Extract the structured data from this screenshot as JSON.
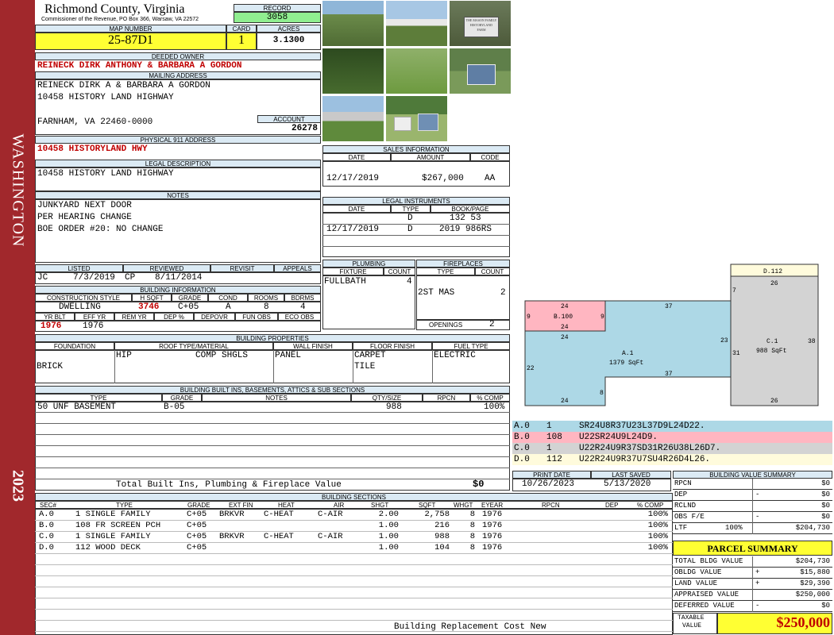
{
  "sidebar": {
    "district": "WASHINGTON",
    "year": "2023"
  },
  "header": {
    "county": "Richmond County, Virginia",
    "commissioner": "Commissioner of the Revenue, PO Box 366, Warsaw, VA 22572",
    "record_label": "RECORD",
    "record": "3058",
    "map_label": "MAP NUMBER",
    "map": "25-87D1",
    "card_label": "CARD",
    "card": "1",
    "acres_label": "ACRES",
    "acres": "3.1300"
  },
  "owner": {
    "label": "DEEDED OWNER",
    "value": "REINECK DIRK ANTHONY & BARBARA A GORDON"
  },
  "mailing": {
    "label": "MAILING ADDRESS",
    "line1": "REINECK DIRK A & BARBARA A GORDON",
    "line2": "10458 HISTORY LAND HIGHWAY",
    "line3": "FARNHAM, VA 22460-0000",
    "account_label": "ACCOUNT",
    "account": "26278"
  },
  "physical": {
    "label": "PHYSICAL 911 ADDRESS",
    "value": "10458 HISTORYLAND HWY"
  },
  "legal": {
    "label": "LEGAL DESCRIPTION",
    "value": "10458 HISTORY LAND HIGHWAY"
  },
  "notes": {
    "label": "NOTES",
    "line1": "JUNKYARD NEXT DOOR",
    "line2": "PER HEARING CHANGE",
    "line3": "BOE ORDER #20: NO CHANGE"
  },
  "photos": {
    "sign_text": "THE MASON FAMILY HISTORYLAND FARM"
  },
  "sales": {
    "label": "SALES INFORMATION",
    "h_date": "DATE",
    "h_amount": "AMOUNT",
    "h_code": "CODE",
    "date": "12/17/2019",
    "amount": "$267,000",
    "code": "AA"
  },
  "instruments": {
    "label": "LEGAL INSTRUMENTS",
    "h_date": "DATE",
    "h_type": "TYPE",
    "h_book": "BOOK/PAGE",
    "r1_type": "D",
    "r1_book": "132 53",
    "r2_date": "12/17/2019",
    "r2_type": "D",
    "r2_book": "2019 986RS"
  },
  "listed": {
    "h_listed": "LISTED",
    "h_reviewed": "REVIEWED",
    "h_revisit": "REVISIT",
    "h_appeals": "APPEALS",
    "lister": "JC",
    "list_date": "7/3/2019",
    "reviewer": "CP",
    "review_date": "8/11/2014"
  },
  "bldg": {
    "label": "BUILDING INFORMATION",
    "h_style": "CONSTRUCTION STYLE",
    "h_hsqft": "H SQFT",
    "h_grade": "GRADE",
    "h_cond": "COND",
    "h_rooms": "ROOMS",
    "h_bdrms": "BDRMS",
    "style": "DWELLING",
    "hsqft": "3746",
    "grade": "C+05",
    "cond": "A",
    "rooms": "8",
    "bdrms": "4",
    "h_yrblt": "YR BLT",
    "h_effyr": "EFF YR",
    "h_remyr": "REM YR",
    "h_dep": "DEP %",
    "h_depovr": "DEPOVR",
    "h_funobs": "FUN OBS",
    "h_ecoobs": "ECO OBS",
    "yrblt": "1976",
    "effyr": "1976"
  },
  "plumbing": {
    "label": "PLUMBING",
    "h_fixture": "FIXTURE",
    "h_count": "COUNT",
    "fixture": "FULLBATH",
    "count": "4"
  },
  "fireplaces": {
    "label": "FIREPLACES",
    "h_type": "TYPE",
    "h_count": "COUNT",
    "type": "2ST MAS",
    "count": "2",
    "openings_label": "OPENINGS",
    "openings": "2"
  },
  "props": {
    "label": "BUILDING PROPERTIES",
    "h_found": "FOUNDATION",
    "h_roof": "ROOF TYPE/MATERIAL",
    "h_wall": "WALL FINISH",
    "h_floor": "FLOOR FINISH",
    "h_fuel": "FUEL TYPE",
    "found": "BRICK",
    "roof_type": "HIP",
    "roof_mat": "COMP SHGLS",
    "wall": "PANEL",
    "floor1": "CARPET",
    "floor2": "TILE",
    "fuel": "ELECTRIC"
  },
  "builtins": {
    "label": "BUILDING BUILT INS, BASEMENTS, ATTICS & SUB SECTIONS",
    "h_type": "TYPE",
    "h_grade": "GRADE",
    "h_notes": "NOTES",
    "h_qty": "QTY/SIZE",
    "h_rpcn": "RPCN",
    "h_comp": "% COMP",
    "type": "50 UNF BASEMENT",
    "grade": "B-05",
    "qty": "988",
    "comp": "100%",
    "total_label": "Total Built Ins, Plumbing & Fireplace Value",
    "total": "$0"
  },
  "sections": {
    "label": "BUILDING SECTIONS",
    "headers": [
      "SEC#",
      "TYPE",
      "GRADE",
      "EXT FIN",
      "HEAT",
      "AIR",
      "SHGT",
      "SQFT",
      "WHGT",
      "EYEAR",
      "RPCN",
      "DEP",
      "% COMP"
    ],
    "rows": [
      {
        "sec": "A.0",
        "type": "1 SINGLE FAMILY",
        "grade": "C+05",
        "ext": "BRKVR",
        "heat": "C-HEAT",
        "air": "C-AIR",
        "shgt": "2.00",
        "sqft": "2,758",
        "whgt": "8",
        "eyear": "1976",
        "comp": "100%"
      },
      {
        "sec": "B.0",
        "type": "108 FR SCREEN PCH",
        "grade": "C+05",
        "ext": "",
        "heat": "",
        "air": "",
        "shgt": "1.00",
        "sqft": "216",
        "whgt": "8",
        "eyear": "1976",
        "comp": "100%"
      },
      {
        "sec": "C.0",
        "type": "1 SINGLE FAMILY",
        "grade": "C+05",
        "ext": "BRKVR",
        "heat": "C-HEAT",
        "air": "C-AIR",
        "shgt": "1.00",
        "sqft": "988",
        "whgt": "8",
        "eyear": "1976",
        "comp": "100%"
      },
      {
        "sec": "D.0",
        "type": "112 WOOD DECK",
        "grade": "C+05",
        "ext": "",
        "heat": "",
        "air": "",
        "shgt": "1.00",
        "sqft": "104",
        "whgt": "8",
        "eyear": "1976",
        "comp": "100%"
      }
    ],
    "footer": "Building Replacement Cost New"
  },
  "sketch": {
    "d_label": "D.112",
    "d_top": "26",
    "d_left": "7",
    "b_top": "24",
    "b_label": "B.100",
    "b_left": "9",
    "b_right": "9",
    "b_bottom": "24",
    "a_top": "37",
    "a_left_top": "24",
    "a_label": "A.1",
    "a_sqft": "1379 SqFt",
    "a_left": "22",
    "a_mid": "37",
    "a_step": "8",
    "a_bottom": "24",
    "c_left_top": "23",
    "c_left": "31",
    "c_label": "C.1",
    "c_sqft": "988 SqFt",
    "c_right": "38",
    "c_bottom": "26",
    "colors": {
      "a": "#add8e6",
      "b": "#ffb6c1",
      "c": "#d3d3d3",
      "d": "#fffbdc"
    }
  },
  "vectors": [
    {
      "sec": "A.0",
      "num": "1",
      "vec": "SR24U8R37U23L37D9L24D22."
    },
    {
      "sec": "B.0",
      "num": "108",
      "vec": "U22SR24U9L24D9."
    },
    {
      "sec": "C.0",
      "num": "1",
      "vec": "U22R24U9R37SD31R26U38L26D7."
    },
    {
      "sec": "D.0",
      "num": "112",
      "vec": "U22R24U9R37U7SU4R26D4L26."
    }
  ],
  "dates": {
    "print_label": "PRINT DATE",
    "saved_label": "LAST SAVED",
    "print": "10/26/2023",
    "saved": "5/13/2020"
  },
  "value_summary": {
    "label": "BUILDING VALUE SUMMARY",
    "rpcn_label": "RPCN",
    "rpcn": "$0",
    "dep_label": "DEP",
    "dep_sign": "-",
    "dep": "$0",
    "rclnd_label": "RCLND",
    "rclnd": "$0",
    "obs_label": "OBS F/E",
    "obs_sign": "-",
    "obs": "$0",
    "ltf_label": "LTF",
    "ltf_pct": "100%",
    "ltf": "$204,730"
  },
  "parcel": {
    "label": "PARCEL SUMMARY",
    "bldg_label": "TOTAL BLDG VALUE",
    "bldg": "$204,730",
    "obldg_label": "OBLDG VALUE",
    "obldg_sign": "+",
    "obldg": "$15,880",
    "land_label": "LAND VALUE",
    "land_sign": "+",
    "land": "$29,390",
    "appr_label": "APPRAISED VALUE",
    "appr": "$250,000",
    "def_label": "DEFERRED VALUE",
    "def_sign": "-",
    "def": "$0",
    "taxable_label1": "TAXABLE",
    "taxable_label2": "VALUE",
    "taxable": "$250,000"
  }
}
